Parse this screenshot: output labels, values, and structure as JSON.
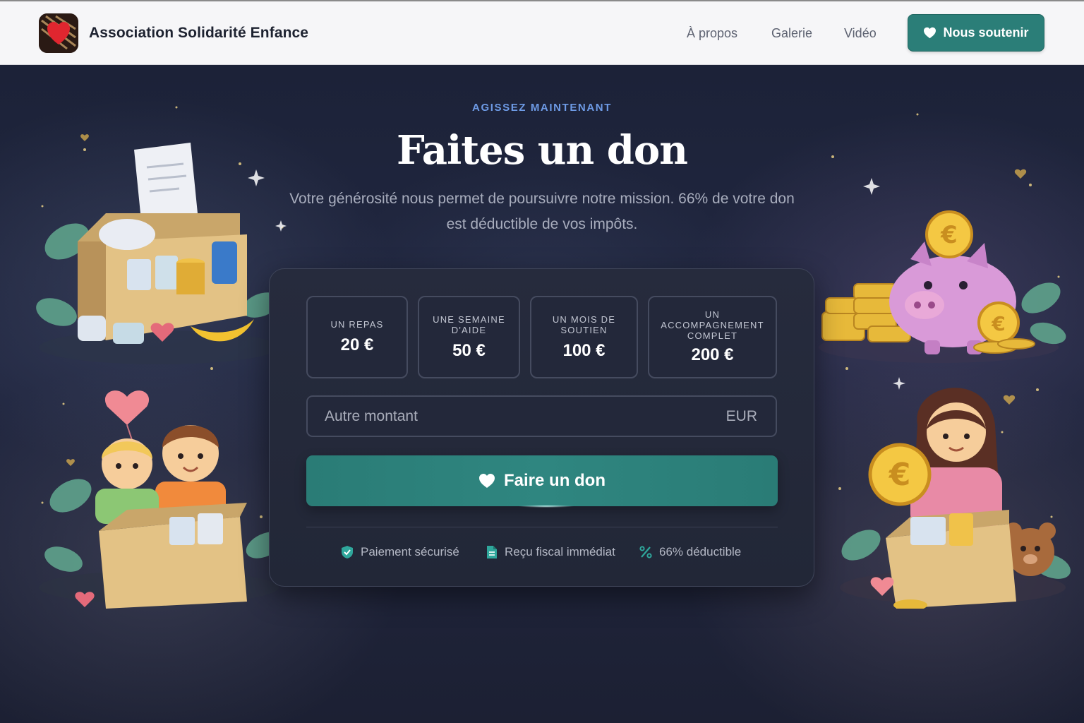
{
  "header": {
    "brand_name": "Association Solidarité Enfance",
    "nav": [
      {
        "label": "À propos"
      },
      {
        "label": "Galerie"
      },
      {
        "label": "Vidéo"
      }
    ],
    "cta_label": "Nous soutenir"
  },
  "hero": {
    "eyebrow": "AGISSEZ MAINTENANT",
    "title": "Faites un don",
    "subtitle": "Votre générosité nous permet de poursuivre notre mission. 66% de votre don est déductible de vos impôts."
  },
  "donation": {
    "tiers": [
      {
        "label": "UN REPAS",
        "value": "20 €"
      },
      {
        "label": "UNE SEMAINE D'AIDE",
        "value": "50 €"
      },
      {
        "label": "UN MOIS DE SOUTIEN",
        "value": "100 €"
      },
      {
        "label": "UN ACCOMPAGNEMENT COMPLET",
        "value": "200 €"
      }
    ],
    "custom_amount": {
      "placeholder": "Autre montant",
      "value": "",
      "currency": "EUR"
    },
    "submit_label": "Faire un don",
    "features": [
      {
        "icon": "shield-check-icon",
        "label": "Paiement sécurisé"
      },
      {
        "icon": "document-icon",
        "label": "Reçu fiscal immédiat"
      },
      {
        "icon": "percent-icon",
        "label": "66% déductible"
      }
    ]
  },
  "colors": {
    "accent": "#2b7e78",
    "eyebrow": "#6e9be6",
    "background": "#1c2238",
    "card": "#262b3d"
  }
}
